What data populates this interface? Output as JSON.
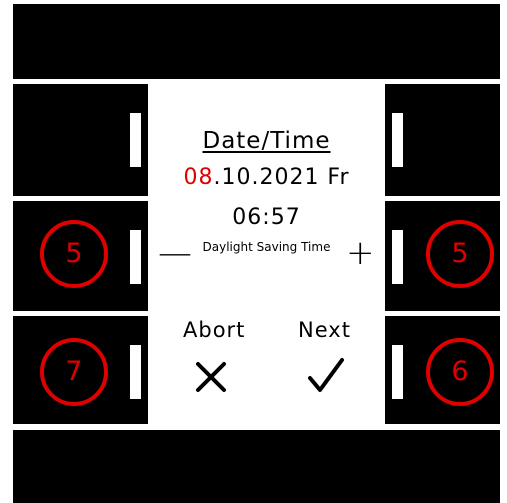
{
  "screen": {
    "title": "Date/Time",
    "date_highlight": "08",
    "date_rest": ".10.2021 Fr",
    "time": "06:57",
    "daylight_label": "Daylight Saving Time",
    "minus_symbol": "—",
    "plus_symbol": "+",
    "abort_label": "Abort",
    "next_label": "Next"
  },
  "markers": {
    "left_middle": "5",
    "right_middle": "5",
    "left_bottom": "7",
    "right_bottom": "6"
  },
  "icons": {
    "abort": "close-icon",
    "next": "checkmark-icon"
  },
  "colors": {
    "frame": "#000000",
    "screen": "#ffffff",
    "accent": "#e00000"
  }
}
